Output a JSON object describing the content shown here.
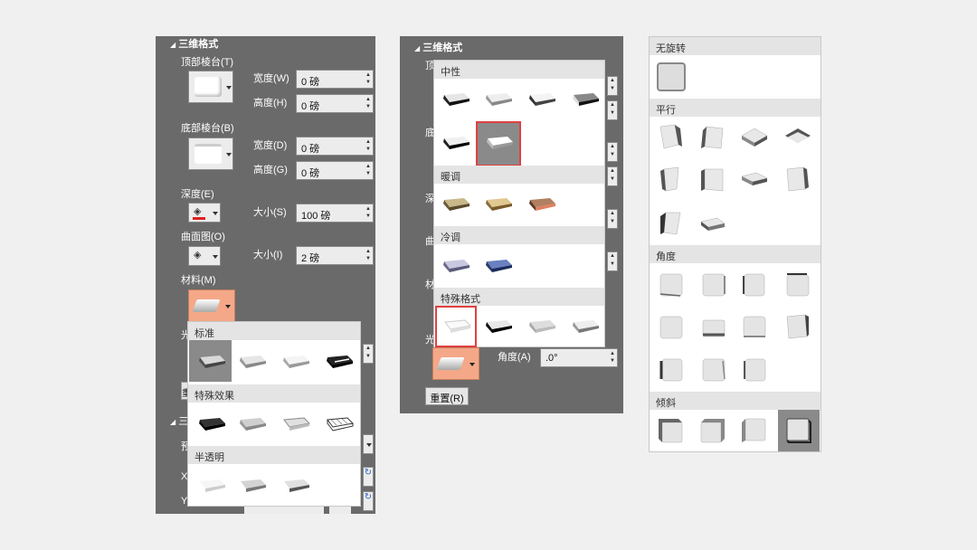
{
  "panel1": {
    "title": "三维格式",
    "top_bevel_label": "顶部棱台(T)",
    "bottom_bevel_label": "底部棱台(B)",
    "width_label": "宽度(W)",
    "height_label": "高度(H)",
    "width_label_b": "宽度(D)",
    "height_label_b": "高度(G)",
    "top_width": "0 磅",
    "top_height": "0 磅",
    "bottom_width": "0 磅",
    "bottom_height": "0 磅",
    "depth_label": "深度(E)",
    "depth_size_label": "大小(S)",
    "depth_size": "100 磅",
    "contour_label": "曲面图(O)",
    "contour_size_label": "大小(I)",
    "contour_size": "2 磅",
    "material_label": "材料(M)",
    "lighting_short": "光",
    "rotation_short": "三",
    "preset_short": "预",
    "x_short": "X",
    "y_short": "Y",
    "reset_short": "重",
    "dropdown": {
      "section_standard": "标准",
      "section_special": "特殊效果",
      "section_translucent": "半透明"
    }
  },
  "panel2": {
    "title": "三维格式",
    "angle_label": "角度(A)",
    "angle_value": ".0°",
    "reset_label": "重置(R)",
    "partial_labels": [
      "顶",
      "底",
      "深",
      "曲",
      "材",
      "光"
    ],
    "dropdown": {
      "section_neutral": "中性",
      "section_warm": "暖调",
      "section_cool": "冷调",
      "section_special": "特殊格式"
    }
  },
  "panel3": {
    "section_none": "无旋转",
    "section_parallel": "平行",
    "section_angle": "角度",
    "section_oblique": "倾斜"
  },
  "colors": {
    "panel_bg": "#6a6a6a",
    "accent_peach": "#f4a888",
    "highlight_red": "#e04040"
  }
}
